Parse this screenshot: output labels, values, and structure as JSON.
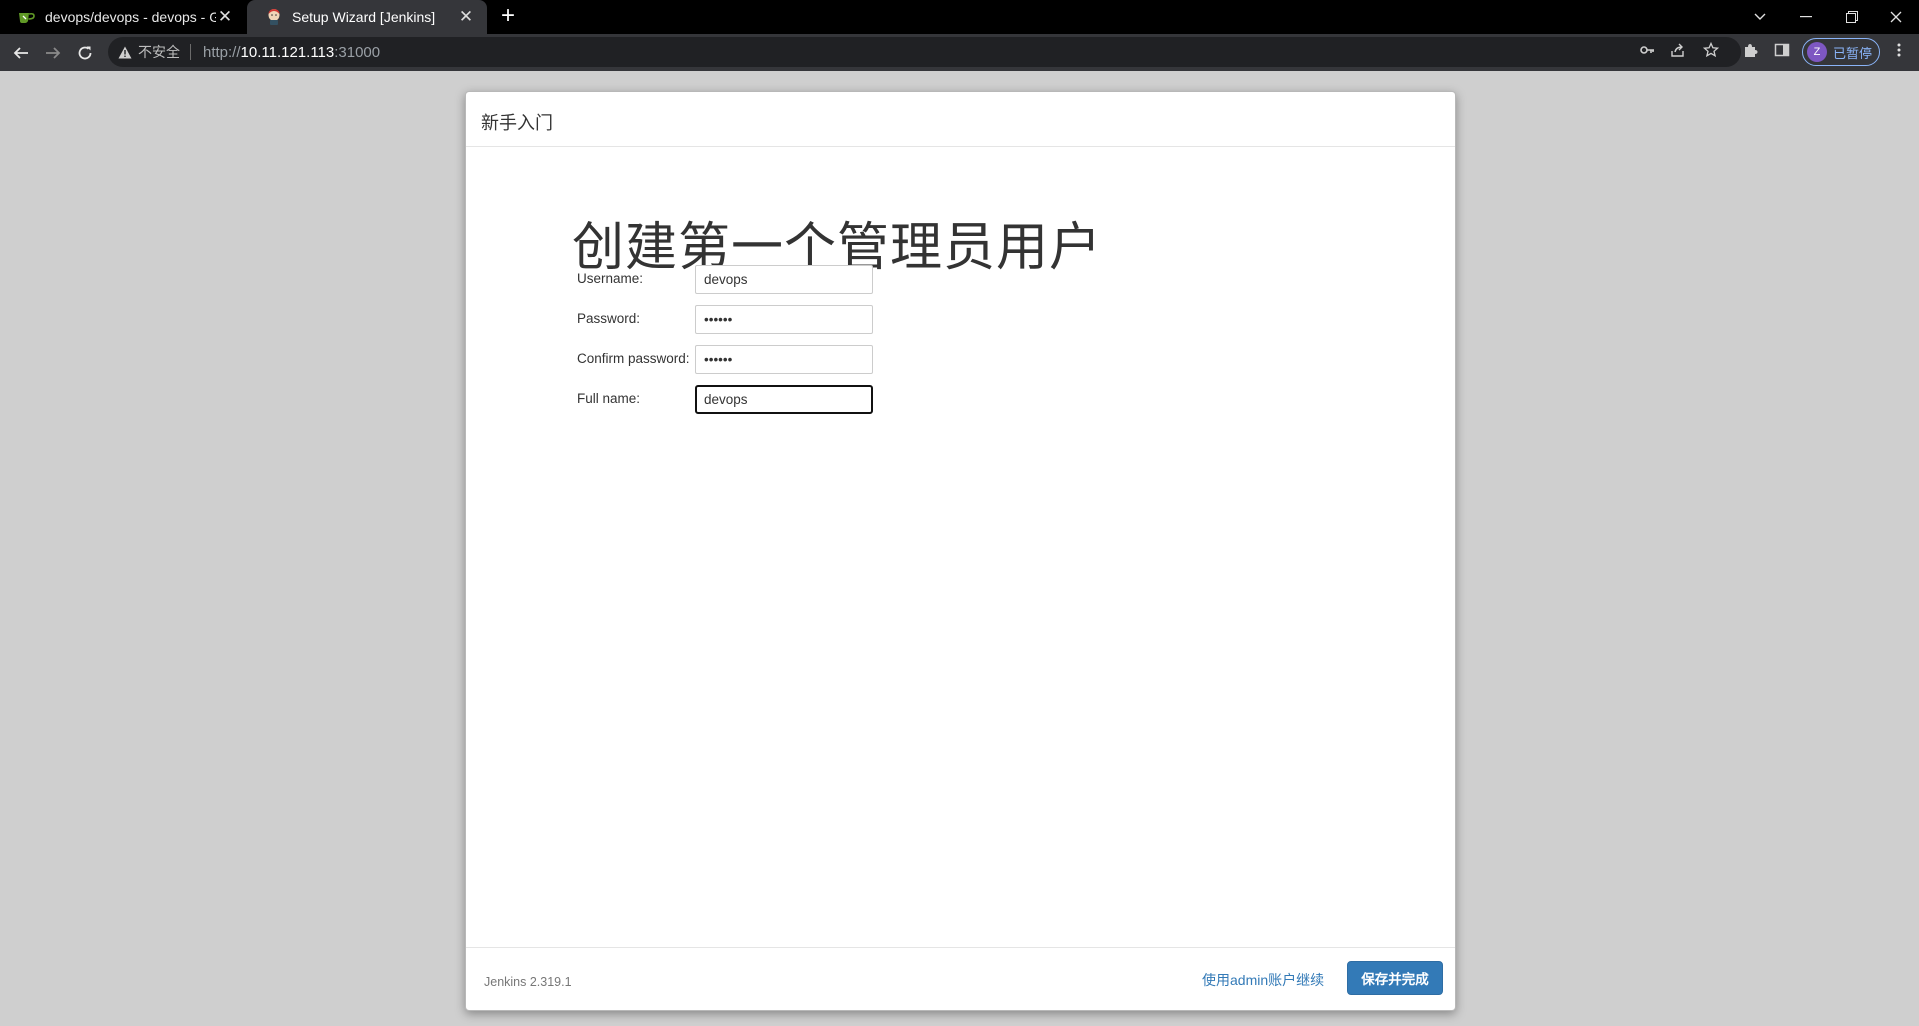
{
  "browser": {
    "tabs": [
      {
        "title": "devops/devops - devops - Git",
        "active": false
      },
      {
        "title": "Setup Wizard [Jenkins]",
        "active": true
      }
    ],
    "address": {
      "security_label": "不安全",
      "url_prefix": "http://",
      "url_host": "10.11.121.113",
      "url_suffix": ":31000"
    },
    "profile": {
      "initial": "Z",
      "label": "已暂停"
    }
  },
  "dialog": {
    "header_title": "新手入门",
    "page_title": "创建第一个管理员用户",
    "fields": [
      {
        "label": "Username:",
        "value": "devops",
        "type": "text"
      },
      {
        "label": "Password:",
        "value": "••••••",
        "type": "password"
      },
      {
        "label": "Confirm password:",
        "value": "••••••",
        "type": "password"
      },
      {
        "label": "Full name:",
        "value": "devops",
        "type": "text"
      }
    ],
    "footer": {
      "version": "Jenkins 2.319.1",
      "skip_link": "使用admin账户继续",
      "save_button": "保存并完成"
    }
  },
  "colors": {
    "primary": "#337ab7",
    "link": "#337ab7",
    "background": "#cfcfcf"
  }
}
